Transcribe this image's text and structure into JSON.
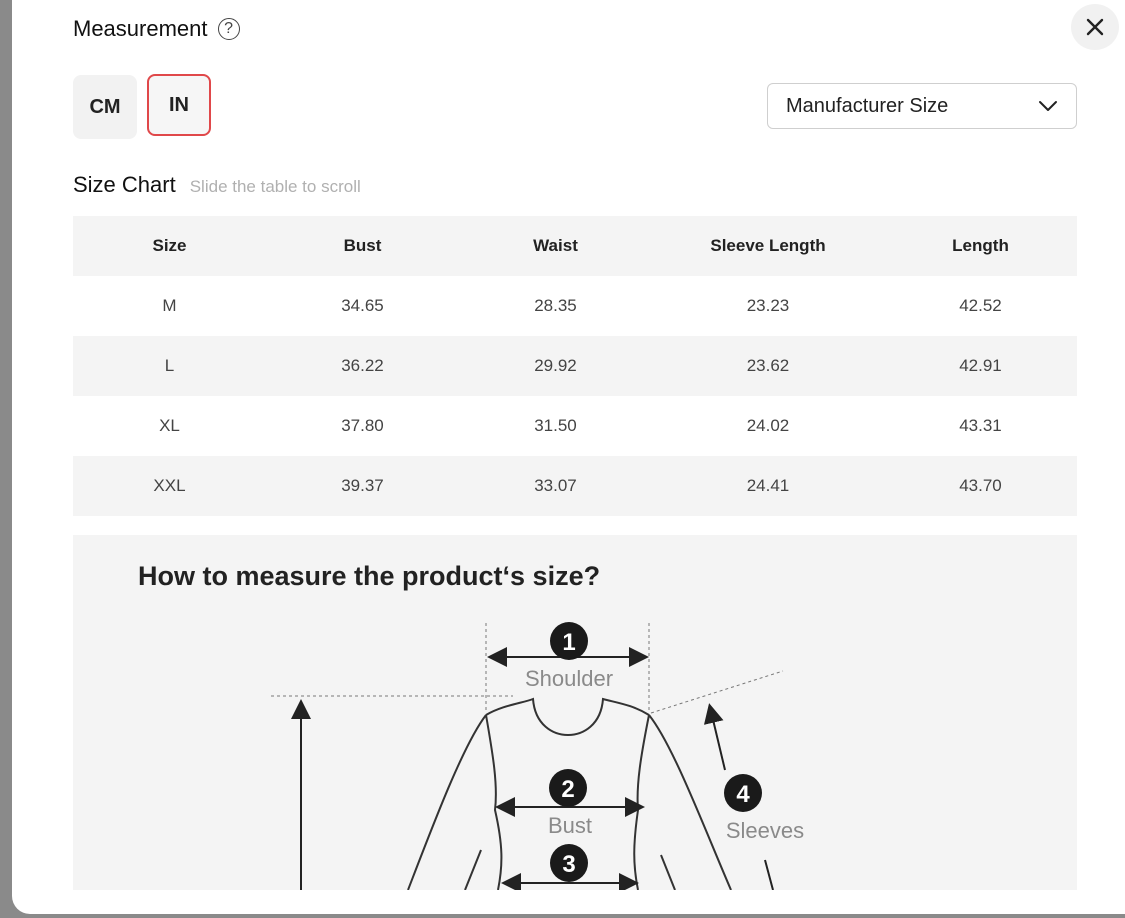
{
  "header": {
    "title": "Measurement",
    "help_glyph": "?",
    "close_glyph": "✕"
  },
  "units": {
    "cm_label": "CM",
    "in_label": "IN",
    "selected": "IN"
  },
  "size_select": {
    "value": "Manufacturer Size"
  },
  "size_chart": {
    "title": "Size Chart",
    "hint": "Slide the table to scroll",
    "columns": [
      "Size",
      "Bust",
      "Waist",
      "Sleeve Length",
      "Length"
    ],
    "rows": [
      [
        "M",
        "34.65",
        "28.35",
        "23.23",
        "42.52"
      ],
      [
        "L",
        "36.22",
        "29.92",
        "23.62",
        "42.91"
      ],
      [
        "XL",
        "37.80",
        "31.50",
        "24.02",
        "43.31"
      ],
      [
        "XXL",
        "39.37",
        "33.07",
        "24.41",
        "43.70"
      ]
    ]
  },
  "guide": {
    "title": "How to measure the product‘s size?",
    "labels": {
      "shoulder": "Shoulder",
      "bust": "Bust",
      "sleeves": "Sleeves"
    },
    "numbers": {
      "n1": "1",
      "n2": "2",
      "n3": "3",
      "n4": "4"
    }
  },
  "colors": {
    "accent_border": "#e0484a",
    "row_alt": "#f4f4f4"
  }
}
